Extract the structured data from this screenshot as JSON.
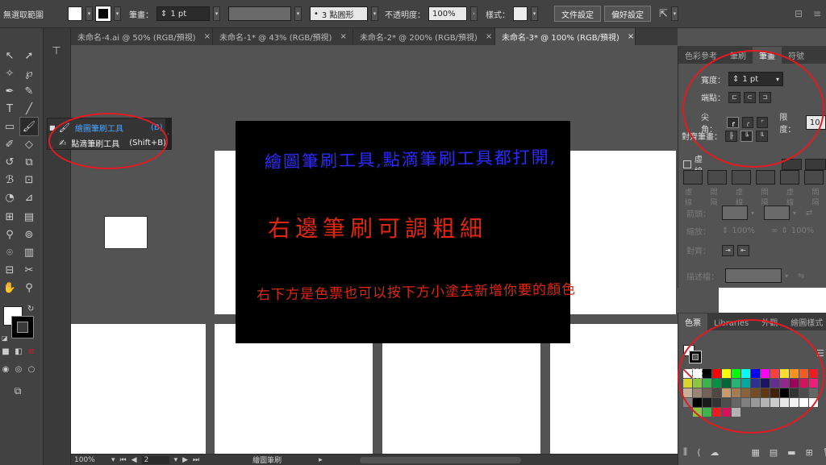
{
  "control_bar": {
    "selection_status": "無選取範圍",
    "stroke_label": "筆畫：",
    "stroke_value": "1 pt",
    "brush_profile": "3 點圓形",
    "opacity_label": "不透明度：",
    "opacity_value": "100%",
    "style_label": "樣式：",
    "doc_setup_button": "文件設定",
    "preferences_button": "偏好設定"
  },
  "tabs": [
    {
      "label": "未命名-4.ai @ 50% (RGB/預視)",
      "active": false
    },
    {
      "label": "未命名-1* @ 43% (RGB/預視)",
      "active": false
    },
    {
      "label": "未命名-2* @ 200% (RGB/預視)",
      "active": false
    },
    {
      "label": "未命名-3* @ 100% (RGB/預視)",
      "active": true
    }
  ],
  "tab_close": "×",
  "flyout": {
    "items": [
      {
        "label": "繪圖筆刷工具",
        "shortcut": "(B)"
      },
      {
        "label": "點滴筆刷工具",
        "shortcut": "(Shift+B)"
      }
    ]
  },
  "annotation": {
    "line1": "繪圖筆刷工具,點滴筆刷工具都打開,",
    "line2": "右邊筆刷可調粗細",
    "line3": "右下方是色票也可以按下方小塗去新增你要的顏色",
    "line1_color": "#2b2bff",
    "line2_color": "#e0260f",
    "line3_color": "#e0260f"
  },
  "stroke_panel": {
    "tabs": [
      "色彩參考",
      "筆刷",
      "筆畫",
      "符號"
    ],
    "active_tab": "筆畫",
    "weight_label": "寬度：",
    "weight_value": "1 pt",
    "cap_label": "端點：",
    "corner_label": "尖角：",
    "limit_label": "限度：",
    "limit_value": "10",
    "align_label": "對齊筆畫：",
    "dashed_label": "虛線",
    "dash_fields": [
      "虛線",
      "間隔",
      "虛線",
      "間隔",
      "虛線",
      "間隔"
    ],
    "arrow_label": "箭頭：",
    "scale_label": "縮放：",
    "scale_values": [
      "100%",
      "100%"
    ],
    "align_arrow_label": "對齊：",
    "profile_label": "描述檔："
  },
  "color_panel": {
    "tabs": [
      "色票",
      "Libraries",
      "外觀",
      "繪圖樣式"
    ],
    "active_tab": "色票",
    "swatches": [
      "#ffffff",
      "#ffffff",
      "#000000",
      "#ff0000",
      "#ffff00",
      "#00ff00",
      "#00ffff",
      "#0000ff",
      "#ff00ff",
      "#ff3f3f",
      "#ffde2b",
      "#f7931e",
      "#f25c24",
      "#ed1c24",
      "#d9d62a",
      "#8cc63f",
      "#39b54a",
      "#009245",
      "#006837",
      "#22b573",
      "#00a99d",
      "#2e3192",
      "#1b1464",
      "#662d91",
      "#93278f",
      "#9e005d",
      "#d4145a",
      "#ed1e79",
      "#c7b299",
      "#998675",
      "#736357",
      "#534741",
      "#c69c6d",
      "#a67c52",
      "#8c6239",
      "#754c24",
      "#603813",
      "#42210b",
      "#000000",
      "#333333",
      "#4d4d4d",
      "#666666",
      "#808080",
      "#000000",
      "#1a1a1a",
      "#333333",
      "#4d4d4d",
      "#666666",
      "#808080",
      "#999999",
      "#b3b3b3",
      "#cccccc",
      "#e6e6e6",
      "#f2f2f2",
      "#ffffff",
      "#ffffff",
      "#535353",
      "#8cc63f",
      "#39b54a",
      "#ed1c24",
      "#d4145a",
      "#b3b3b3"
    ]
  },
  "status_bar": {
    "zoom": "100%",
    "artboard": "2",
    "tool_name": "繪圖筆刷"
  },
  "colors": {
    "accent_red": "#e21b23",
    "panel_bg": "#535353",
    "dark_bg": "#424242"
  }
}
